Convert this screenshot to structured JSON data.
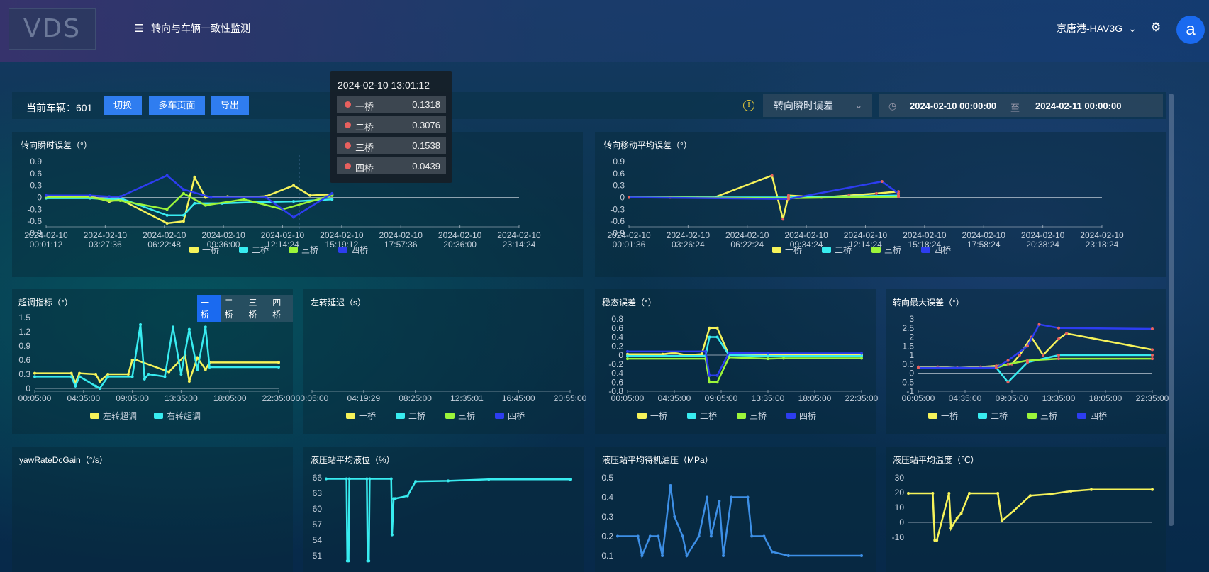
{
  "header": {
    "logo_text": "VDS",
    "page_title": "转向与车辆一致性监测",
    "vehicle": "京唐港-HAV3G",
    "avatar_letter": "a"
  },
  "toolbar": {
    "current_label": "当前车辆：",
    "current_vehicle": "601",
    "switch_label": "切换",
    "multi_label": "多车页面",
    "export_label": "导出",
    "metric_selected": "转向瞬时误差",
    "date_start": "2024-02-10 00:00:00",
    "date_to": "至",
    "date_end": "2024-02-11 00:00:00"
  },
  "tooltip": {
    "time": "2024-02-10 13:01:12",
    "rows": [
      {
        "name": "一桥",
        "value": "0.1318"
      },
      {
        "name": "二桥",
        "value": "0.3076"
      },
      {
        "name": "三桥",
        "value": "0.1538"
      },
      {
        "name": "四桥",
        "value": "0.0439"
      }
    ]
  },
  "colors": {
    "bridge1": "#f6f35a",
    "bridge2": "#38ecf0",
    "bridge3": "#9cf53a",
    "bridge4": "#2d3df0",
    "marker": "#e8605e",
    "blue_line": "#3d8fe6"
  },
  "bridges": [
    "一桥",
    "二桥",
    "三桥",
    "四桥"
  ],
  "overshoot_tabs": [
    "一桥",
    "二桥",
    "三桥",
    "四桥"
  ],
  "chart_data": [
    {
      "id": "inst",
      "type": "line",
      "title": "转向瞬时误差（°）",
      "yticks": [
        "0.9",
        "0.6",
        "0.3",
        "0",
        "-0.3",
        "-0.6",
        "-0.9"
      ],
      "xticks": [
        [
          "2024-02-10",
          "00:01:12"
        ],
        [
          "2024-02-10",
          "03:27:36"
        ],
        [
          "2024-02-10",
          "06:22:48"
        ],
        [
          "2024-02-10",
          "09:36:00"
        ],
        [
          "2024-02-10",
          "12:14:24"
        ],
        [
          "2024-02-10",
          "15:19:12"
        ],
        [
          "2024-02-10",
          "17:57:36"
        ],
        [
          "2024-02-10",
          "20:36:00"
        ],
        [
          "2024-02-10",
          "23:14:24"
        ]
      ],
      "ylim": [
        -0.9,
        0.9
      ],
      "series": [
        {
          "name": "一桥",
          "x": [
            0,
            0.8,
            1.15,
            1.35,
            2.2,
            2.5,
            2.7,
            2.9,
            3.3,
            3.6,
            4.0,
            4.5,
            4.8,
            5.2
          ],
          "y": [
            0.03,
            0.03,
            -0.1,
            -0.05,
            -0.65,
            -0.6,
            0.5,
            0.0,
            0.02,
            0.01,
            0.03,
            0.3,
            0.05,
            0.08
          ]
        },
        {
          "name": "二桥",
          "x": [
            0,
            0.8,
            1.15,
            1.35,
            2.2,
            2.5,
            2.7,
            3.2,
            3.8,
            4.5,
            5.2
          ],
          "y": [
            -0.02,
            -0.02,
            -0.05,
            -0.02,
            -0.45,
            -0.45,
            -0.15,
            -0.15,
            -0.12,
            -0.1,
            -0.05
          ]
        },
        {
          "name": "三桥",
          "x": [
            0,
            0.8,
            1.15,
            1.35,
            2.2,
            2.5,
            2.9,
            3.6,
            4.3,
            5.2
          ],
          "y": [
            0.0,
            0.0,
            -0.08,
            -0.08,
            -0.3,
            0.1,
            -0.2,
            -0.05,
            -0.3,
            0.05
          ]
        },
        {
          "name": "四桥",
          "x": [
            0,
            0.8,
            1.15,
            1.35,
            2.2,
            2.5,
            3.0,
            4.0,
            4.5,
            5.2
          ],
          "y": [
            0.05,
            0.05,
            0.02,
            0.02,
            0.55,
            0.2,
            0.0,
            0.0,
            -0.5,
            0.1
          ]
        }
      ],
      "legend": [
        "一桥",
        "二桥",
        "三桥",
        "四桥"
      ],
      "marker": {
        "x": 4.6
      }
    },
    {
      "id": "mavg",
      "type": "line",
      "title": "转向移动平均误差（°）",
      "yticks": [
        "0.9",
        "0.6",
        "0.3",
        "0",
        "-0.3",
        "-0.6",
        "-0.9"
      ],
      "xticks": [
        [
          "2024-02-10",
          "00:01:36"
        ],
        [
          "2024-02-10",
          "03:26:24"
        ],
        [
          "2024-02-10",
          "06:22:24"
        ],
        [
          "2024-02-10",
          "09:34:24"
        ],
        [
          "2024-02-10",
          "12:14:24"
        ],
        [
          "2024-02-10",
          "15:18:24"
        ],
        [
          "2024-02-10",
          "17:58:24"
        ],
        [
          "2024-02-10",
          "20:38:24"
        ],
        [
          "2024-02-10",
          "23:18:24"
        ]
      ],
      "ylim": [
        -0.9,
        0.9
      ],
      "series": [
        {
          "name": "一桥",
          "x": [
            0,
            0.75,
            1.25,
            1.55,
            2.6,
            2.8,
            2.9,
            3.5,
            4.0,
            4.5,
            4.9
          ],
          "y": [
            0.0,
            0.0,
            0.0,
            0.0,
            0.55,
            -0.55,
            0.05,
            0.0,
            0.05,
            0.1,
            0.15
          ]
        },
        {
          "name": "二桥",
          "x": [
            0,
            2.9,
            4.9
          ],
          "y": [
            0.0,
            0.0,
            0.05
          ]
        },
        {
          "name": "三桥",
          "x": [
            0,
            2.9,
            4.9
          ],
          "y": [
            0.0,
            -0.02,
            0.02
          ]
        },
        {
          "name": "四桥",
          "x": [
            0,
            2.9,
            4.6,
            4.9
          ],
          "y": [
            0.0,
            -0.04,
            0.4,
            0.1
          ]
        }
      ],
      "legend": [
        "一桥",
        "二桥",
        "三桥",
        "四桥"
      ]
    },
    {
      "id": "over",
      "type": "line",
      "title": "超调指标（°）",
      "yticks": [
        "1.5",
        "1.2",
        "0.9",
        "0.6",
        "0.3",
        "0"
      ],
      "xticks": [
        "00:05:00",
        "04:35:00",
        "09:05:00",
        "13:35:00",
        "18:05:00",
        "22:35:00"
      ],
      "ylim": [
        0,
        1.5
      ],
      "series": [
        {
          "name": "左转超调",
          "x": [
            0,
            0.9,
            1.0,
            1.1,
            1.5,
            1.6,
            1.8,
            2.3,
            2.4,
            2.5,
            3.3,
            3.7,
            3.8,
            4.0,
            4.2,
            4.3,
            6.0
          ],
          "y": [
            0.32,
            0.32,
            0.12,
            0.32,
            0.3,
            0.15,
            0.3,
            0.3,
            0.6,
            0.6,
            0.35,
            0.7,
            0.15,
            0.65,
            0.4,
            0.55,
            0.55
          ]
        },
        {
          "name": "右转超调",
          "x": [
            0,
            0.9,
            1.0,
            1.1,
            1.5,
            1.6,
            1.8,
            2.4,
            2.6,
            2.7,
            2.8,
            3.2,
            3.4,
            3.6,
            3.8,
            4.0,
            4.2,
            4.3,
            6.0
          ],
          "y": [
            0.25,
            0.25,
            0.05,
            0.25,
            0.05,
            0.0,
            0.25,
            0.25,
            1.35,
            0.2,
            0.3,
            0.25,
            1.3,
            0.3,
            1.25,
            0.4,
            1.3,
            0.45,
            0.45
          ]
        }
      ],
      "legend": [
        "左转超调",
        "右转超调"
      ]
    },
    {
      "id": "delay",
      "type": "line",
      "title": "左转延迟（s）",
      "xticks": [
        "00:05:00",
        "04:19:29",
        "08:25:00",
        "12:35:01",
        "16:45:00",
        "20:55:00"
      ],
      "series": [],
      "legend": [
        "一桥",
        "二桥",
        "三桥",
        "四桥"
      ]
    },
    {
      "id": "steady",
      "type": "line",
      "title": "稳态误差（°）",
      "yticks": [
        "0.8",
        "0.6",
        "0.4",
        "0.2",
        "0",
        "-0.2",
        "-0.4",
        "-0.6",
        "-0.8"
      ],
      "xticks": [
        "00:05:00",
        "04:35:00",
        "09:05:00",
        "13:35:00",
        "18:05:00",
        "22:35:00"
      ],
      "ylim": [
        -0.8,
        0.8
      ],
      "series": [
        {
          "name": "一桥",
          "x": [
            0,
            0.9,
            1.2,
            1.5,
            1.9,
            2.1,
            2.3,
            2.6,
            3.4,
            3.9,
            6.0
          ],
          "y": [
            0.02,
            0.02,
            0.05,
            0.0,
            0.02,
            0.6,
            0.6,
            0.0,
            0.02,
            0.0,
            0.0
          ]
        },
        {
          "name": "二桥",
          "x": [
            0,
            2.0,
            2.1,
            2.3,
            2.6,
            3.6,
            6.0
          ],
          "y": [
            -0.02,
            -0.02,
            0.4,
            0.4,
            0.0,
            -0.02,
            -0.02
          ]
        },
        {
          "name": "三桥",
          "x": [
            0,
            2.0,
            2.1,
            2.3,
            2.6,
            3.6,
            4.0,
            6.0
          ],
          "y": [
            -0.08,
            -0.08,
            -0.6,
            -0.6,
            -0.05,
            -0.08,
            -0.07,
            -0.07
          ]
        },
        {
          "name": "四桥",
          "x": [
            0,
            2.0,
            2.1,
            2.3,
            2.6,
            3.6,
            6.0
          ],
          "y": [
            0.08,
            0.08,
            -0.45,
            -0.45,
            0.05,
            0.04,
            0.04
          ]
        }
      ],
      "legend": [
        "一桥",
        "二桥",
        "三桥",
        "四桥"
      ]
    },
    {
      "id": "max",
      "type": "line",
      "title": "转向最大误差（°）",
      "yticks": [
        "3",
        "2.5",
        "2",
        "1.5",
        "1",
        "0.5",
        "0",
        "-0.5",
        "-1"
      ],
      "xticks": [
        "00:05:00",
        "04:35:00",
        "09:05:00",
        "13:35:00",
        "18:05:00",
        "22:35:00"
      ],
      "ylim": [
        -1,
        3
      ],
      "series": [
        {
          "name": "一桥",
          "x": [
            0,
            0.5,
            1.0,
            1.6,
            2.0,
            2.4,
            2.6,
            2.9,
            3.2,
            3.6,
            3.8,
            6.0
          ],
          "y": [
            0.35,
            0.35,
            0.3,
            0.35,
            0.4,
            0.5,
            1.0,
            2.0,
            1.0,
            1.9,
            2.2,
            1.3
          ]
        },
        {
          "name": "二桥",
          "x": [
            0,
            2.0,
            2.3,
            2.8,
            3.6,
            6.0
          ],
          "y": [
            0.3,
            0.3,
            -0.5,
            0.6,
            1.0,
            1.0
          ]
        },
        {
          "name": "三桥",
          "x": [
            0,
            2.0,
            2.3,
            2.8,
            3.6,
            6.0
          ],
          "y": [
            0.3,
            0.3,
            0.5,
            0.7,
            0.8,
            0.8
          ]
        },
        {
          "name": "四桥",
          "x": [
            0,
            2.0,
            2.3,
            2.8,
            3.1,
            3.6,
            6.0
          ],
          "y": [
            0.3,
            0.3,
            0.7,
            1.5,
            2.7,
            2.5,
            2.45
          ]
        }
      ],
      "legend": [
        "一桥",
        "二桥",
        "三桥",
        "四桥"
      ]
    },
    {
      "id": "yaw",
      "type": "line",
      "title": "yawRateDcGain（°/s）",
      "series": []
    },
    {
      "id": "level",
      "type": "line",
      "title": "液压站平均液位（%）",
      "yticks": [
        "66",
        "63",
        "60",
        "57",
        "54",
        "51"
      ],
      "ylim": [
        51,
        66
      ],
      "series": [
        {
          "name": "",
          "x": [
            0,
            0.5,
            0.52,
            0.55,
            0.57,
            1.0,
            1.02,
            1.05,
            1.07,
            1.6,
            1.62,
            1.66,
            1.7,
            2.0,
            2.2,
            3.0,
            4.0,
            6.0
          ],
          "y": [
            65.8,
            65.8,
            50,
            50,
            65.8,
            65.8,
            50,
            50,
            65.8,
            65.8,
            55,
            62,
            62,
            62.5,
            65.3,
            65.4,
            65.7,
            65.7
          ]
        }
      ]
    },
    {
      "id": "press",
      "type": "line",
      "title": "液压站平均待机油压（MPa）",
      "yticks": [
        "0.5",
        "0.4",
        "0.3",
        "0.2",
        "0.1"
      ],
      "ylim": [
        0.1,
        0.5
      ],
      "series": [
        {
          "name": "",
          "x": [
            0,
            0.5,
            0.6,
            0.8,
            1.0,
            1.1,
            1.3,
            1.4,
            1.6,
            1.7,
            2.0,
            2.2,
            2.3,
            2.5,
            2.6,
            2.8,
            3.2,
            3.3,
            3.6,
            3.8,
            4.2,
            6.0
          ],
          "y": [
            0.2,
            0.2,
            0.1,
            0.2,
            0.2,
            0.1,
            0.46,
            0.3,
            0.2,
            0.1,
            0.2,
            0.4,
            0.2,
            0.38,
            0.1,
            0.4,
            0.4,
            0.2,
            0.2,
            0.12,
            0.1,
            0.1
          ]
        }
      ]
    },
    {
      "id": "temp",
      "type": "line",
      "title": "液压站平均温度（℃）",
      "yticks": [
        "30",
        "20",
        "10",
        "0",
        "-10"
      ],
      "ylim": [
        -10,
        30
      ],
      "series": [
        {
          "name": "",
          "x": [
            0,
            0.6,
            0.65,
            0.7,
            1.0,
            1.05,
            1.2,
            1.3,
            1.5,
            2.2,
            2.3,
            2.6,
            3.0,
            3.5,
            4.0,
            4.5,
            6.0
          ],
          "y": [
            19.5,
            19.5,
            -12,
            -12,
            19.5,
            -4,
            3,
            6,
            19.5,
            19.5,
            1,
            8,
            18,
            19,
            21,
            22,
            22
          ]
        }
      ]
    }
  ]
}
